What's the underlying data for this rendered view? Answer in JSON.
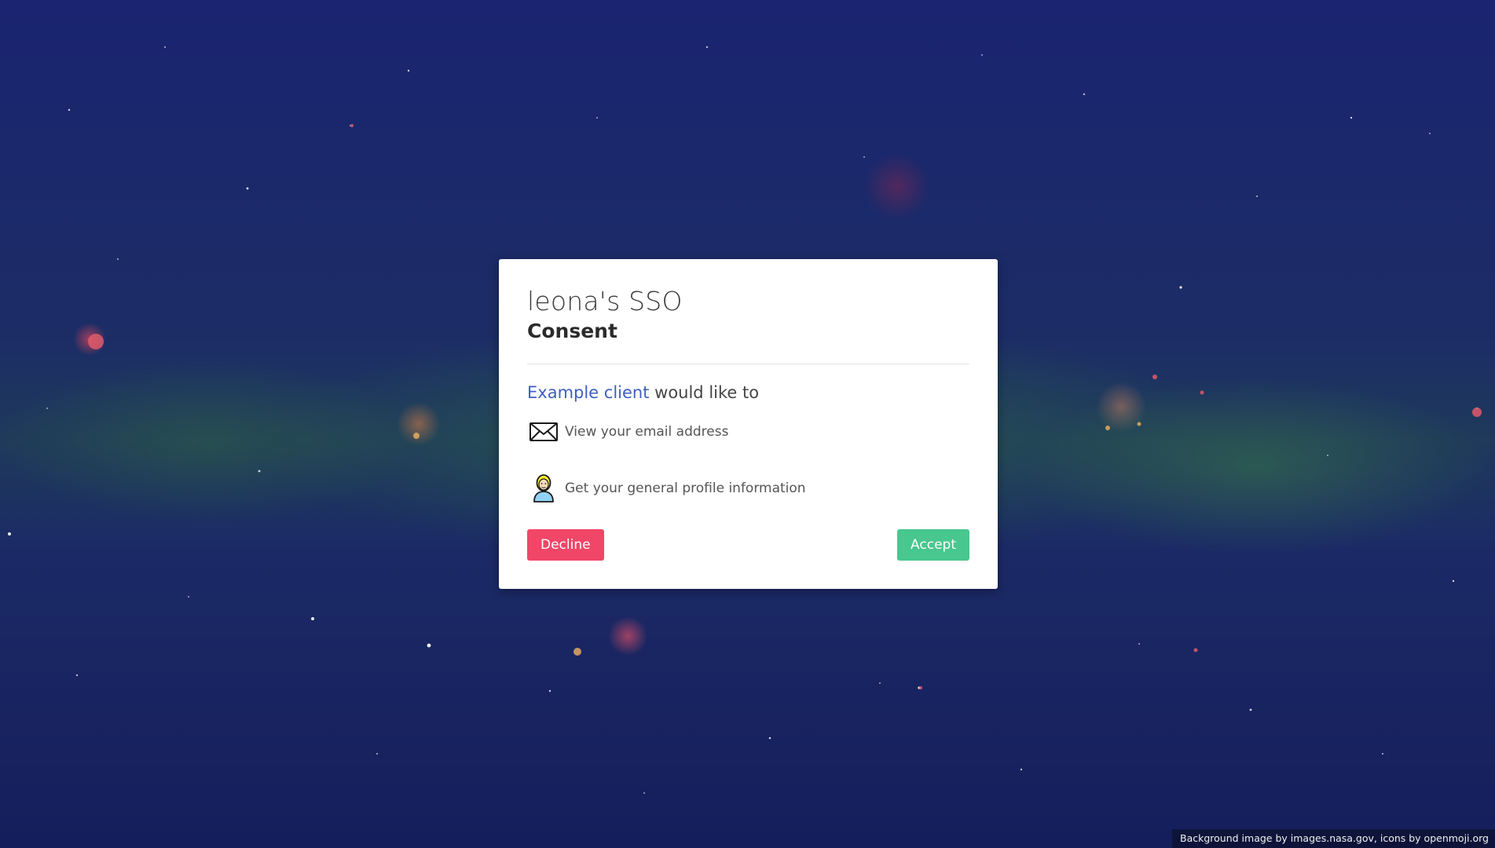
{
  "card": {
    "title": "leona's SSO",
    "subtitle": "Consent",
    "request": {
      "client_name": "Example client",
      "suffix": " would like to"
    },
    "scopes": [
      {
        "icon": "envelope-icon",
        "label": "View your email address"
      },
      {
        "icon": "person-icon",
        "label": "Get your general profile information"
      }
    ],
    "decline_label": "Decline",
    "accept_label": "Accept"
  },
  "footer": {
    "credit": "Background image by images.nasa.gov, icons by openmoji.org"
  },
  "colors": {
    "client_link": "#3f5fc2",
    "decline": "#f14668",
    "accept": "#48c78e",
    "background": "#16205a"
  }
}
